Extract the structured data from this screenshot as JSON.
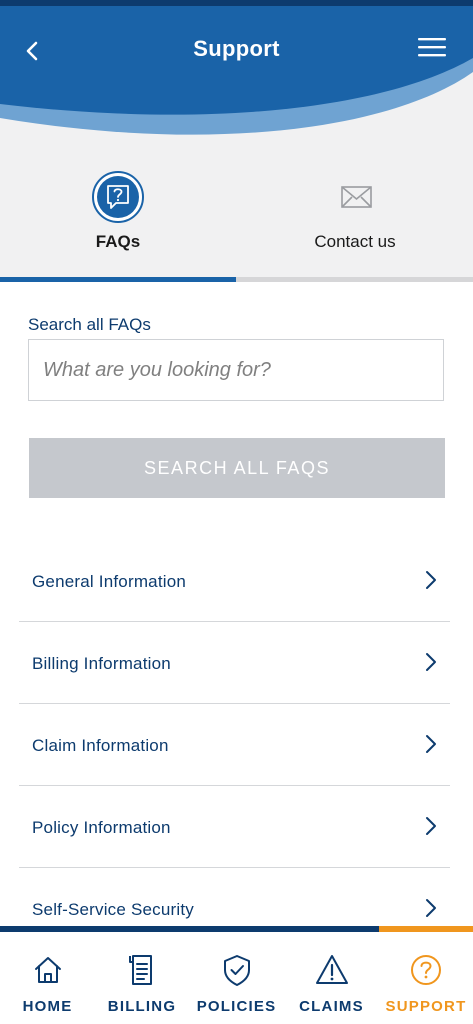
{
  "header": {
    "title": "Support"
  },
  "tabs": [
    {
      "label": "FAQs",
      "icon": "question-bubble-icon",
      "active": true
    },
    {
      "label": "Contact us",
      "icon": "envelope-icon",
      "active": false
    }
  ],
  "search": {
    "label": "Search all FAQs",
    "placeholder": "What are you looking for?",
    "button_label": "SEARCH ALL FAQS"
  },
  "faq_items": [
    {
      "label": "General Information"
    },
    {
      "label": "Billing Information"
    },
    {
      "label": "Claim Information"
    },
    {
      "label": "Policy Information"
    },
    {
      "label": "Self-Service Security"
    }
  ],
  "bottom_nav": [
    {
      "label": "HOME",
      "icon": "home-icon",
      "active": false
    },
    {
      "label": "BILLING",
      "icon": "billing-icon",
      "active": false
    },
    {
      "label": "POLICIES",
      "icon": "shield-check-icon",
      "active": false
    },
    {
      "label": "CLAIMS",
      "icon": "warning-icon",
      "active": false
    },
    {
      "label": "SUPPORT",
      "icon": "question-circle-icon",
      "active": true
    }
  ],
  "colors": {
    "brand_blue": "#1a63a8",
    "navy": "#0d3b6e",
    "accent_orange": "#f0961e",
    "disabled_button": "#c5c8cd"
  }
}
